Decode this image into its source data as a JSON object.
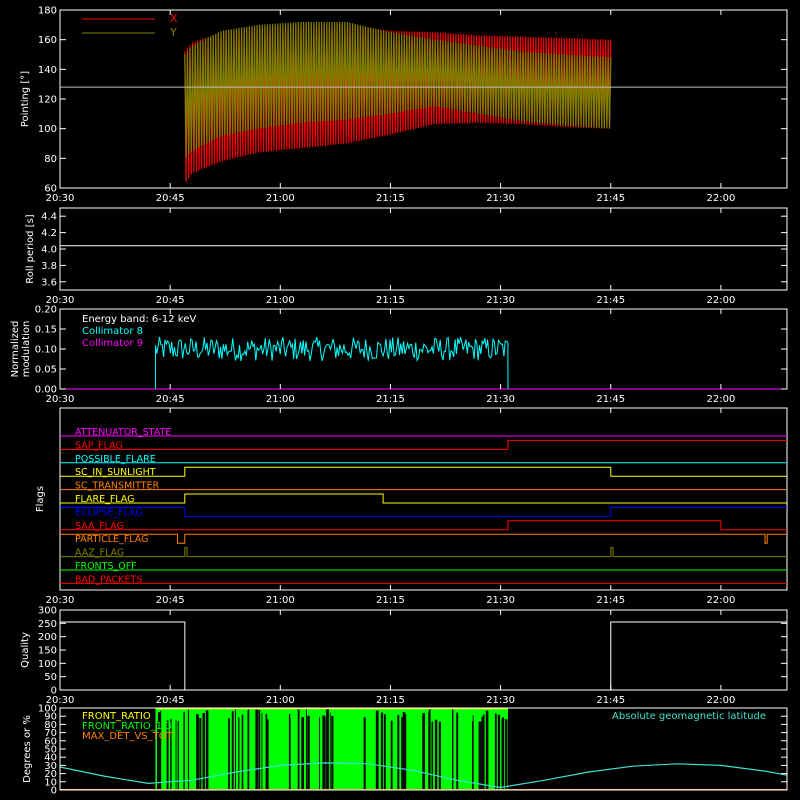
{
  "colors": {
    "background": "#000000",
    "axes": "#ffffff",
    "x_series": "#ff0000",
    "y_series": "#808000",
    "collimator8": "#00ffff",
    "collimator9": "#ff00ff",
    "flag_bright_green": "#00ff00",
    "geomag": "#40e0d0"
  },
  "time_axis": {
    "ticks": [
      "20:30",
      "20:45",
      "21:00",
      "21:15",
      "21:30",
      "21:45",
      "22:00"
    ],
    "tick_minutes": [
      0,
      15,
      30,
      45,
      60,
      75,
      90
    ],
    "range_minutes": [
      0,
      99
    ]
  },
  "chart_data": [
    {
      "id": "pointing",
      "type": "area",
      "ylabel": "Pointing [°]",
      "ylim": [
        60,
        180
      ],
      "yticks": [
        "60",
        "80",
        "100",
        "120",
        "140",
        "160",
        "180"
      ],
      "ytick_values": [
        60,
        80,
        100,
        120,
        140,
        160,
        180
      ],
      "reference_line": 128,
      "series": [
        {
          "name": "X",
          "color": "#ff0000",
          "x_minutes": [
            17,
            18,
            22,
            27,
            33,
            39,
            45,
            51,
            57,
            63,
            69,
            75
          ],
          "upper": [
            152,
            158,
            165,
            168,
            170,
            170,
            166,
            165,
            163,
            162,
            161,
            160
          ],
          "lower": [
            63,
            70,
            78,
            84,
            87,
            90,
            96,
            103,
            104,
            103,
            101,
            100
          ]
        },
        {
          "name": "Y",
          "color": "#808000",
          "x_minutes": [
            17,
            18,
            22,
            27,
            33,
            39,
            45,
            51,
            57,
            63,
            69,
            75
          ],
          "upper": [
            150,
            156,
            166,
            170,
            172,
            172,
            165,
            160,
            156,
            152,
            150,
            148
          ],
          "lower": [
            80,
            85,
            95,
            100,
            104,
            106,
            110,
            115,
            110,
            105,
            102,
            100
          ]
        }
      ]
    },
    {
      "id": "roll",
      "type": "line",
      "ylabel": "Roll period [s]",
      "ylim": [
        3.5,
        4.5
      ],
      "yticks": [
        "3.6",
        "3.8",
        "4.0",
        "4.2",
        "4.4"
      ],
      "ytick_values": [
        3.6,
        3.8,
        4.0,
        4.2,
        4.4
      ],
      "series": [
        {
          "x_minutes": [
            0,
            99
          ],
          "values": [
            4.04,
            4.04
          ],
          "color": "#ffffff"
        }
      ]
    },
    {
      "id": "modulation",
      "type": "line",
      "ylabel_lines": [
        "Normalized",
        "modulation"
      ],
      "ylim": [
        0,
        0.2
      ],
      "yticks": [
        "0.00",
        "0.05",
        "0.10",
        "0.15",
        "0.20"
      ],
      "ytick_values": [
        0,
        0.05,
        0.1,
        0.15,
        0.2
      ],
      "annotation": "Energy band: 6-12 keV",
      "series": [
        {
          "name": "Collimator 8",
          "color": "#00ffff",
          "x_range": [
            13,
            61
          ],
          "mean": 0.1,
          "spread": 0.03
        },
        {
          "name": "Collimator 9",
          "color": "#ff00ff",
          "x_minutes": [
            0,
            99
          ],
          "values": [
            0,
            0
          ]
        }
      ]
    },
    {
      "id": "flags",
      "type": "line",
      "ylabel": "Flags",
      "rows": [
        {
          "name": "ATTENUATOR_STATE",
          "color": "#ff00ff",
          "x_minutes": [
            0,
            99
          ],
          "levels": [
            0,
            0
          ]
        },
        {
          "name": "SAP_FLAG",
          "color": "#ff0000",
          "x_minutes": [
            0,
            61,
            61,
            99
          ],
          "levels": [
            0,
            0,
            1,
            1
          ]
        },
        {
          "name": "POSSIBLE_FLARE",
          "color": "#00ffff",
          "x_minutes": [
            0,
            99
          ],
          "levels": [
            0,
            0
          ]
        },
        {
          "name": "SC_IN_SUNLIGHT",
          "color": "#ffff00",
          "x_minutes": [
            0,
            17,
            17,
            75,
            75,
            99
          ],
          "levels": [
            0,
            0,
            1,
            1,
            0,
            0
          ]
        },
        {
          "name": "SC_TRANSMITTER",
          "color": "#ff8000",
          "x_minutes": [
            0,
            99
          ],
          "levels": [
            0,
            0
          ]
        },
        {
          "name": "FLARE_FLAG",
          "color": "#ffff00",
          "x_minutes": [
            0,
            17,
            17,
            44,
            44,
            99
          ],
          "levels": [
            0,
            0,
            1,
            1,
            0,
            0
          ]
        },
        {
          "name": "ECLIPSE_FLAG",
          "color": "#0000ff",
          "x_minutes": [
            0,
            17,
            17,
            75,
            75,
            99
          ],
          "levels": [
            1,
            1,
            0,
            0,
            1,
            1
          ]
        },
        {
          "name": "SAA_FLAG",
          "color": "#ff0000",
          "x_minutes": [
            0,
            61,
            61,
            90,
            90,
            99
          ],
          "levels": [
            0,
            0,
            1,
            1,
            0,
            0
          ]
        },
        {
          "name": "PARTICLE_FLAG",
          "color": "#ff8000",
          "x_minutes": [
            0,
            16,
            16,
            17,
            17,
            96,
            96,
            96.3,
            96.3,
            99
          ],
          "levels": [
            1,
            1,
            0,
            0,
            1,
            1,
            0,
            0,
            1,
            1
          ]
        },
        {
          "name": "AAZ_FLAG",
          "color": "#808000",
          "x_minutes": [
            0,
            17,
            17,
            17.3,
            17.3,
            75,
            75,
            75.3,
            75.3,
            99
          ],
          "levels": [
            0,
            0,
            1,
            1,
            0,
            0,
            1,
            1,
            0,
            0
          ]
        },
        {
          "name": "FRONTS_OFF",
          "color": "#00ff00",
          "x_minutes": [
            0,
            99
          ],
          "levels": [
            0,
            0
          ]
        },
        {
          "name": "BAD_PACKETS",
          "color": "#ff0000",
          "x_minutes": [
            0,
            99
          ],
          "levels": [
            0,
            0
          ]
        }
      ]
    },
    {
      "id": "quality",
      "type": "line",
      "ylabel": "Quality",
      "ylim": [
        0,
        300
      ],
      "yticks": [
        "0",
        "50",
        "100",
        "150",
        "200",
        "250",
        "300"
      ],
      "ytick_values": [
        0,
        50,
        100,
        150,
        200,
        250,
        300
      ],
      "series": [
        {
          "x_minutes": [
            0,
            17,
            17,
            75,
            75,
            99
          ],
          "values": [
            255,
            255,
            0,
            0,
            255,
            255
          ],
          "color": "#ffffff"
        }
      ]
    },
    {
      "id": "geomag",
      "type": "bar",
      "ylabel": "Degrees or %",
      "ylim": [
        0,
        100
      ],
      "yticks": [
        "0",
        "10",
        "20",
        "30",
        "40",
        "50",
        "60",
        "70",
        "80",
        "90",
        "100"
      ],
      "ytick_values": [
        0,
        10,
        20,
        30,
        40,
        50,
        60,
        70,
        80,
        90,
        100
      ],
      "legend": [
        {
          "name": "FRONT_RATIO",
          "color": "#ffff00"
        },
        {
          "name": "FRONT_RATIO_1-3",
          "color": "#00ff00"
        },
        {
          "name": "MAX_DET_VS_TOT",
          "color": "#ff8000"
        }
      ],
      "annotation": "Absolute geomagnetic latitude",
      "bars": {
        "color": "#00ff00",
        "x_range": [
          13,
          61
        ],
        "top": 100
      },
      "geomag_line": {
        "x_minutes": [
          0,
          6,
          12,
          18,
          24,
          30,
          36,
          42,
          48,
          54,
          60,
          66,
          72,
          78,
          84,
          90,
          96,
          99
        ],
        "values": [
          28,
          17,
          8,
          12,
          22,
          30,
          33,
          32,
          24,
          12,
          3,
          12,
          22,
          29,
          32,
          30,
          23,
          18
        ]
      }
    }
  ]
}
